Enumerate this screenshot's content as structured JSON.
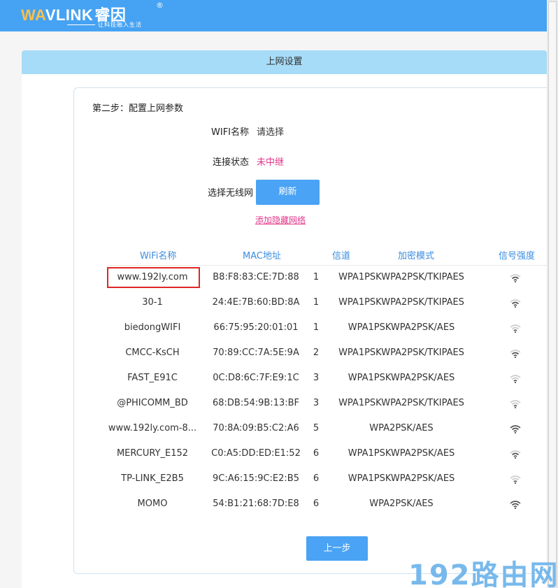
{
  "brand": {
    "logo_wa": "WA",
    "logo_link": "VLINK",
    "logo_cn": "睿因",
    "registered": "®",
    "slogan": "让科技融入生活"
  },
  "panel": {
    "title": "上网设置",
    "step_title": "第二步：配置上网参数"
  },
  "form": {
    "wifi_name_label": "WIFI名称",
    "wifi_name_value": "请选择",
    "status_label": "连接状态",
    "status_value": "未中继",
    "select_label": "选择无线网",
    "refresh_label": "刷新",
    "hidden_link": "添加隐藏网络"
  },
  "table": {
    "headers": {
      "name": "WiFi名称",
      "mac": "MAC地址",
      "channel": "信道",
      "encryption": "加密模式",
      "signal": "信号强度"
    },
    "rows": [
      {
        "name": "www.192ly.com",
        "mac": "B8:F8:83:CE:7D:88",
        "channel": "1",
        "encryption": "WPA1PSKWPA2PSK/TKIPAES",
        "signal": "wifi-signal-icon"
      },
      {
        "name": "30-1",
        "mac": "24:4E:7B:60:BD:8A",
        "channel": "1",
        "encryption": "WPA1PSKWPA2PSK/TKIPAES",
        "signal": "wifi-signal-icon"
      },
      {
        "name": "biedongWIFI",
        "mac": "66:75:95:20:01:01",
        "channel": "1",
        "encryption": "WPA1PSKWPA2PSK/AES",
        "signal": "wifi-signal-icon"
      },
      {
        "name": "CMCC-KsCH",
        "mac": "70:89:CC:7A:5E:9A",
        "channel": "2",
        "encryption": "WPA1PSKWPA2PSK/TKIPAES",
        "signal": "wifi-signal-icon"
      },
      {
        "name": "FAST_E91C",
        "mac": "0C:D8:6C:7F:E9:1C",
        "channel": "3",
        "encryption": "WPA1PSKWPA2PSK/AES",
        "signal": "wifi-signal-icon"
      },
      {
        "name": "@PHICOMM_BD",
        "mac": "68:DB:54:9B:13:BF",
        "channel": "3",
        "encryption": "WPA1PSKWPA2PSK/TKIPAES",
        "signal": "wifi-signal-icon"
      },
      {
        "name": "www.192ly.com-8...",
        "mac": "70:8A:09:B5:C2:A6",
        "channel": "5",
        "encryption": "WPA2PSK/AES",
        "signal": "wifi-signal-icon"
      },
      {
        "name": "MERCURY_E152",
        "mac": "C0:A5:DD:ED:E1:52",
        "channel": "6",
        "encryption": "WPA1PSKWPA2PSK/AES",
        "signal": "wifi-signal-icon"
      },
      {
        "name": "TP-LINK_E2B5",
        "mac": "9C:A6:15:9C:E2:B5",
        "channel": "6",
        "encryption": "WPA1PSKWPA2PSK/AES",
        "signal": "wifi-signal-icon"
      },
      {
        "name": "MOMO",
        "mac": "54:B1:21:68:7D:E8",
        "channel": "6",
        "encryption": "WPA2PSK/AES",
        "signal": "wifi-signal-icon"
      }
    ]
  },
  "prev_button": "上一步",
  "watermark": "192路由网",
  "colors": {
    "topbar": "#46a2f2",
    "panel_header": "#a6dcf7",
    "button": "#4aa3f4",
    "accent_pink": "#e3358a",
    "header_text": "#3b8de0",
    "highlight": "#e02626"
  }
}
